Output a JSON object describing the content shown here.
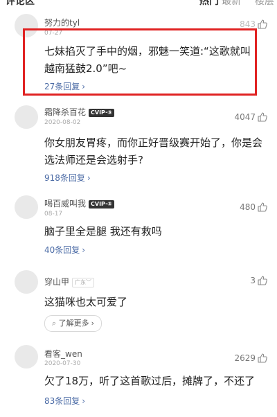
{
  "header": {
    "title": "评论区",
    "sort_hot": "热门",
    "sort_option_1": "最新",
    "sort_option_2": "楼层"
  },
  "comments": [
    {
      "user": "努力的tyl",
      "date": "07-27",
      "likes": "843",
      "text": "七妹掐灭了手中的烟，邪魅一笑道:“这歌就叫越南猛鼓2.0”吧~",
      "replies": "27条回复"
    },
    {
      "user": "霜降杀百花",
      "badge": "CVIP·⑧",
      "date": "2020-08-02",
      "likes": "4047",
      "text": "你女朋友胃疼，而你正好晋级赛开始了，你是会选法师还是会选射手?",
      "replies": "918条回复"
    },
    {
      "user": "喝百威叫我",
      "badge": "CVIP·⑤",
      "date": "08-17",
      "likes": "480",
      "text": "脑子里全是腿 我还有救吗",
      "replies": "40条回复"
    },
    {
      "user": "穿山甲",
      "location": "广东",
      "likes": "3",
      "text": "这猫咪也太可爱了",
      "learn_more": "了解更多"
    },
    {
      "user": "看客_wen",
      "date": "2020-07-30",
      "likes": "2629",
      "text": "欠了18万，听了这首歌过后，摊牌了，不还了",
      "replies": "83条回复"
    }
  ],
  "colors": {
    "highlight_border": "#e02222",
    "reply_link": "#4a6aa5"
  },
  "icons": {
    "like": "thumbs-up-icon",
    "more": "chevron-right-icon",
    "learn_more": "tag-icon"
  }
}
